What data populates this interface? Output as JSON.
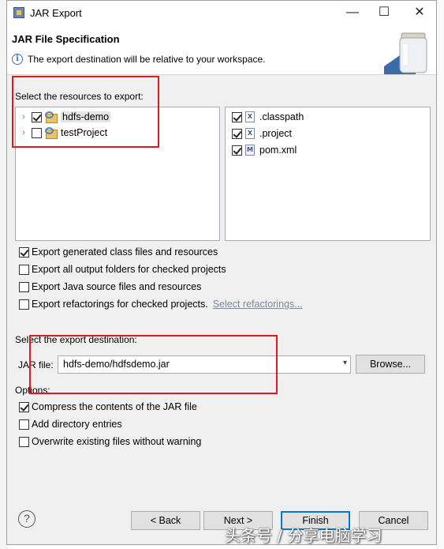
{
  "window": {
    "title": "JAR Export",
    "minimize": "—",
    "maximize": "☐",
    "close": "✕"
  },
  "header": {
    "title": "JAR File Specification",
    "description": "The export destination will be relative to your workspace."
  },
  "resources": {
    "label": "Select the resources to export:",
    "projects": [
      {
        "name": "hdfs-demo",
        "checked": true
      },
      {
        "name": "testProject",
        "checked": false
      }
    ],
    "files": [
      {
        "name": ".classpath",
        "checked": true,
        "icon": "X"
      },
      {
        "name": ".project",
        "checked": true,
        "icon": "X"
      },
      {
        "name": "pom.xml",
        "checked": true,
        "icon": "M"
      }
    ]
  },
  "export_options": {
    "generated": {
      "label": "Export generated class files and resources",
      "checked": true
    },
    "output_folders": {
      "label": "Export all output folders for checked projects",
      "checked": false
    },
    "java_source": {
      "label": "Export Java source files and resources",
      "checked": false
    },
    "refactorings": {
      "label": "Export refactorings for checked projects.",
      "checked": false
    },
    "select_refactorings": "Select refactorings..."
  },
  "destination": {
    "label": "Select the export destination:",
    "jar_label": "JAR file:",
    "jar_value": "hdfs-demo/hdfsdemo.jar",
    "browse": "Browse..."
  },
  "options": {
    "label": "Options:",
    "compress": {
      "label": "Compress the contents of the JAR file",
      "checked": true
    },
    "directory": {
      "label": "Add directory entries",
      "checked": false
    },
    "overwrite": {
      "label": "Overwrite existing files without warning",
      "checked": false
    }
  },
  "buttons": {
    "help": "?",
    "back": "< Back",
    "next": "Next >",
    "finish": "Finish",
    "cancel": "Cancel"
  },
  "watermark": "头条号 / 分享电脑学习",
  "colors": {
    "annotation": "#e0191f",
    "focus": "#0078d7"
  }
}
